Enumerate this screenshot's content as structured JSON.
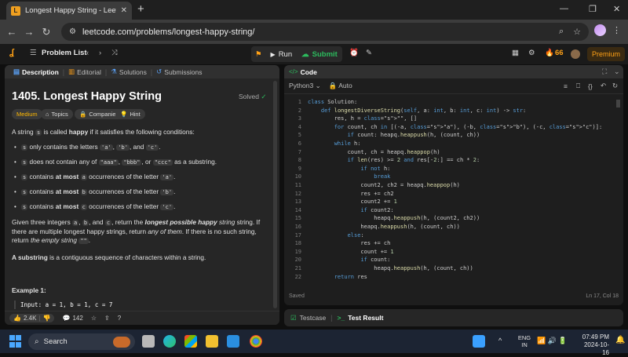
{
  "browser": {
    "tab_title": "Longest Happy String - LeetCod",
    "url": "leetcode.com/problems/longest-happy-string/"
  },
  "lc_nav": {
    "problem_list": "Problem List",
    "run": "Run",
    "submit": "Submit",
    "streak": "66",
    "premium": "Premium"
  },
  "left_tabs": [
    {
      "label": "Description"
    },
    {
      "label": "Editorial"
    },
    {
      "label": "Solutions"
    },
    {
      "label": "Submissions"
    }
  ],
  "problem": {
    "title": "1405. Longest Happy String",
    "solved": "Solved",
    "difficulty": "Medium",
    "topics": "Topics",
    "companies": "Companies",
    "hint": "Hint",
    "intro_pre": "A string ",
    "intro_code": "s",
    "intro_mid": " is called ",
    "intro_bold": "happy",
    "intro_post": " if it satisfies the following conditions:",
    "b1_pre": " only contains the letters ",
    "b1_a": "'a'",
    "b1_b": "'b'",
    "b1_and": ", and ",
    "b1_c": "'c'",
    "b2_pre": " does not contain any of ",
    "b2_x": "\"aaa\"",
    "b2_y": "\"bbb\"",
    "b2_or": ", or ",
    "b2_z": "\"ccc\"",
    "b2_post": " as a substring.",
    "b3_pre": " contains ",
    "b3_bold": "at most",
    "b3_mid": " occurrences of the letter ",
    "b3_l": "'a'",
    "b4_l": "'b'",
    "b5_l": "'c'",
    "var_s": "s",
    "var_a": "a",
    "var_b": "b",
    "var_c": "c",
    "given_1": "Given three integers ",
    "given_2": ", return the ",
    "given_3": "longest possible happy",
    "given_4": " string. If there are multiple longest happy strings, return ",
    "given_5": "any of them",
    "given_6": ". If there is no such string, return ",
    "given_7": "the empty string",
    "given_8": "\"\"",
    "substring_bold": "A substring",
    "substring_rest": " is a contiguous sequence of characters within a string.",
    "example_title": "Example 1:",
    "example_input": "Input: a = 1, b = 1, c = 7"
  },
  "left_bottom": {
    "likes": "2.4K",
    "comments": "142"
  },
  "code_panel": {
    "title": "Code",
    "language": "Python3",
    "auto": "Auto",
    "status_left": "Saved",
    "status_right": "Ln 17, Col 18",
    "lines": [
      "class Solution:",
      "    def longestDiverseString(self, a: int, b: int, c: int) -> str:",
      "        res, h = \"\", []",
      "        for count, ch in [(-a, \"a\"), (-b, \"b\"), (-c, \"c\")]:",
      "            if count: heapq.heappush(h, (count, ch))",
      "        while h:",
      "            count, ch = heapq.heappop(h)",
      "            if len(res) >= 2 and res[-2:] == ch * 2:",
      "                if not h:",
      "                    break",
      "                count2, ch2 = heapq.heappop(h)",
      "                res += ch2",
      "                count2 += 1",
      "                if count2:",
      "                    heapq.heappush(h, (count2, ch2))",
      "                heapq.heappush(h, (count, ch))",
      "            else:",
      "                res += ch",
      "                count += 1",
      "                if count:",
      "                    heapq.heappush(h, (count, ch))",
      "        return res"
    ]
  },
  "test_panel": {
    "testcase": "Testcase",
    "result": "Test Result"
  },
  "taskbar": {
    "search": "Search",
    "lang1": "ENG",
    "lang2": "IN",
    "time": "07:49 PM",
    "date": "2024-10-16"
  }
}
